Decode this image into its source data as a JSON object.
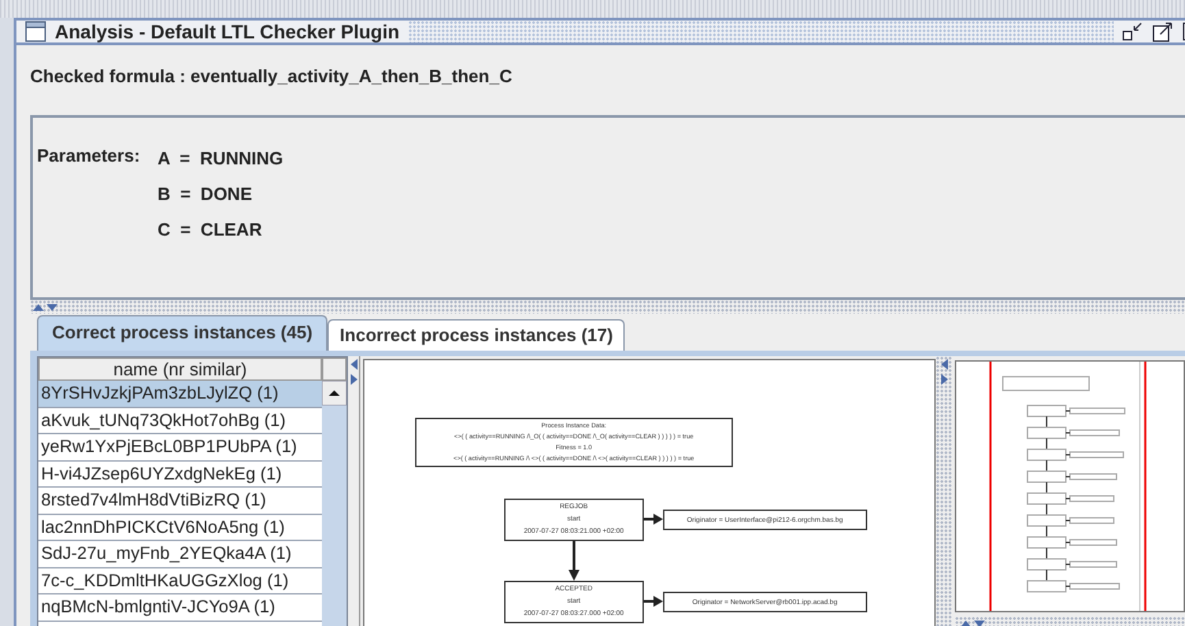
{
  "window": {
    "title": "Analysis - Default LTL Checker Plugin"
  },
  "formula": "Checked formula : eventually_activity_A_then_B_then_C",
  "parameters": {
    "label": "Parameters:",
    "items": [
      {
        "text": "A  =  RUNNING"
      },
      {
        "text": "B  =  DONE"
      },
      {
        "text": "C  =  CLEAR"
      }
    ]
  },
  "tabs": [
    {
      "label": "Correct process instances (45)",
      "selected": true
    },
    {
      "label": "Incorrect process instances (17)",
      "selected": false
    }
  ],
  "table": {
    "columns": [
      "name (nr similar)"
    ],
    "rows": [
      {
        "name": "8YrSHvJzkjPAm3zbLJylZQ (1)",
        "selected": true
      },
      {
        "name": "aKvuk_tUNq73QkHot7ohBg (1)",
        "selected": false
      },
      {
        "name": "yeRw1YxPjEBcL0BP1PUbPA (1)",
        "selected": false
      },
      {
        "name": "H-vi4JZsep6UYZxdgNekEg (1)",
        "selected": false
      },
      {
        "name": "8rsted7v4lmH8dVtiBizRQ (1)",
        "selected": false
      },
      {
        "name": "lac2nnDhPICKCtV6NoA5ng (1)",
        "selected": false
      },
      {
        "name": "SdJ-27u_myFnb_2YEQka4A (1)",
        "selected": false
      },
      {
        "name": "7c-c_KDDmltHKaUGGzXlog (1)",
        "selected": false
      },
      {
        "name": "nqBMcN-bmlgntiV-JCYo9A (1)",
        "selected": false
      }
    ]
  },
  "graph": {
    "info": [
      "Process Instance Data:",
      "<>( ( activity==RUNNING /\\_O( ( activity==DONE /\\_O( activity==CLEAR ) ) ) ) ) = true",
      "Fitness = 1.0",
      "<>( ( activity==RUNNING /\\ <>( ( activity==DONE /\\ <>( activity==CLEAR ) ) ) ) ) = true"
    ],
    "nodes": [
      {
        "lines": [
          "REGJOB",
          "start",
          "2007-07-27 08:03:21.000 +02:00"
        ],
        "originator": "Originator = UserInterface@pi212-6.orgchm.bas.bg"
      },
      {
        "lines": [
          "ACCEPTED",
          "start",
          "2007-07-27 08:03:27.000 +02:00"
        ],
        "originator": "Originator = NetworkServer@rb001.ipp.acad.bg"
      }
    ]
  }
}
